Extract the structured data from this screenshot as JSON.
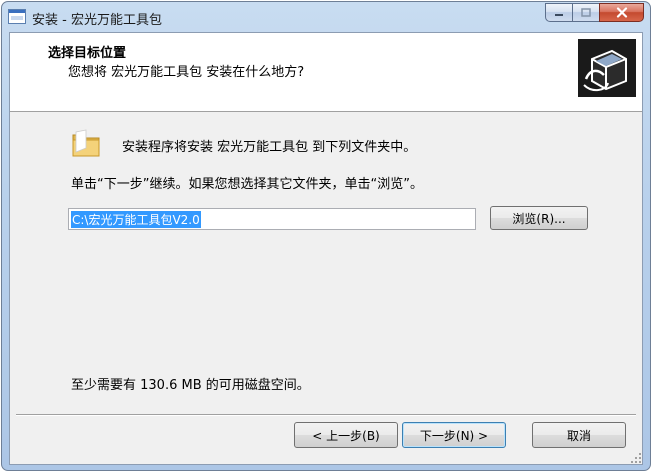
{
  "window": {
    "title": "安装 - 宏光万能工具包"
  },
  "header": {
    "title": "选择目标位置",
    "subtitle": "您想将 宏光万能工具包 安装在什么地方?"
  },
  "body": {
    "intro": "安装程序将安装 宏光万能工具包 到下列文件夹中。",
    "instruction": "单击“下一步”继续。如果您想选择其它文件夹，单击“浏览”。",
    "path_value": "C:\\宏光万能工具包V2.0",
    "browse_label": "浏览(R)...",
    "disk_space": "至少需要有 130.6 MB 的可用磁盘空间。"
  },
  "footer": {
    "back_label": "< 上一步(B)",
    "next_label": "下一步(N) >",
    "cancel_label": "取消"
  },
  "colors": {
    "selection": "#3399ff",
    "close_button": "#c44a2f"
  },
  "icons": {
    "app": "installer-app-icon",
    "header_logo": "installer-box-logo",
    "folder": "folder-icon"
  }
}
